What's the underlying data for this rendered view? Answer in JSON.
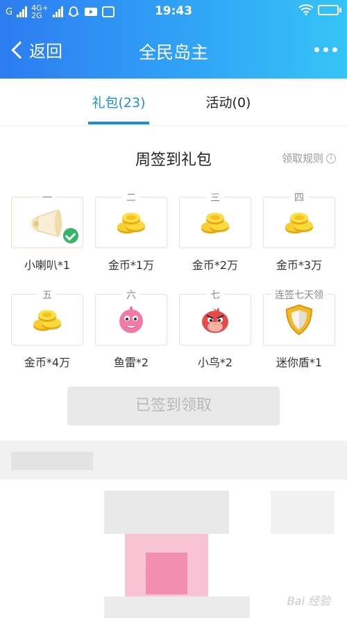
{
  "status_bar": {
    "carrier_left": "G",
    "network_top": "4G+",
    "network_bottom": "2G",
    "time": "19:43",
    "icons": [
      "signal-icon",
      "qq-icon",
      "video-icon",
      "compass-icon",
      "wifi-icon",
      "battery-icon"
    ]
  },
  "header": {
    "back_label": "返回",
    "title": "全民岛主",
    "more_icon": "more-icon"
  },
  "tabs": [
    {
      "label": "礼包(23)",
      "active": true
    },
    {
      "label": "活动(0)",
      "active": false
    }
  ],
  "week_sign": {
    "title": "周签到礼包",
    "rules_label": "领取规则",
    "rules_icon": "i",
    "rewards": [
      {
        "day": "一",
        "name": "小喇叭*1",
        "icon": "megaphone-icon",
        "claimed": true
      },
      {
        "day": "二",
        "name": "金币*1万",
        "icon": "coins-icon",
        "claimed": false
      },
      {
        "day": "三",
        "name": "金币*2万",
        "icon": "coins-icon",
        "claimed": false
      },
      {
        "day": "四",
        "name": "金币*3万",
        "icon": "coins-icon",
        "claimed": false
      },
      {
        "day": "五",
        "name": "金币*4万",
        "icon": "coins-icon",
        "claimed": false
      },
      {
        "day": "六",
        "name": "鱼雷*2",
        "icon": "pink-fish-icon",
        "claimed": false
      },
      {
        "day": "七",
        "name": "小鸟*2",
        "icon": "red-bird-icon",
        "claimed": false
      },
      {
        "day": "连签七天领",
        "name": "迷你盾*1",
        "icon": "shield-icon",
        "claimed": false
      }
    ],
    "button_label": "已签到领取"
  },
  "watermark": "Bai 经验",
  "colors": {
    "header_gradient_start": "#2d7cf0",
    "header_gradient_end": "#35c4f6",
    "tab_active": "#1a8fd8",
    "claimed_check": "#35b46a"
  }
}
